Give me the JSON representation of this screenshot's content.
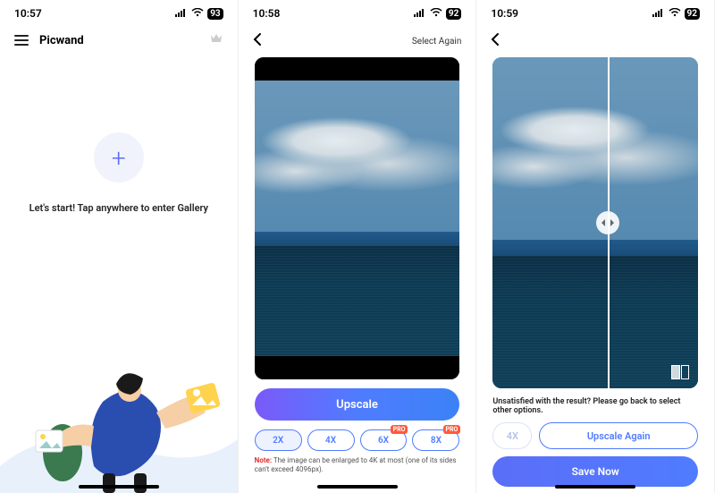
{
  "screen1": {
    "status": {
      "time": "10:57",
      "battery": "93"
    },
    "app_title": "Picwand",
    "cta_text": "Let's start! Tap anywhere to enter Gallery"
  },
  "screen2": {
    "status": {
      "time": "10:58",
      "battery": "92"
    },
    "select_again": "Select Again",
    "upscale_label": "Upscale",
    "pills": [
      {
        "label": "2X",
        "active": true,
        "pro": false
      },
      {
        "label": "4X",
        "active": false,
        "pro": false
      },
      {
        "label": "6X",
        "active": false,
        "pro": true
      },
      {
        "label": "8X",
        "active": false,
        "pro": true
      }
    ],
    "pro_label": "PRO",
    "note_prefix": "Note:",
    "note_text": " The image can be enlarged to 4K at most (one of its sides can't exceed 4096px)."
  },
  "screen3": {
    "status": {
      "time": "10:59",
      "battery": "92"
    },
    "msg": "Unsatisfied with the result? Please go back to select other options.",
    "x4_label": "4X",
    "upscale_again": "Upscale Again",
    "save_now": "Save Now"
  }
}
